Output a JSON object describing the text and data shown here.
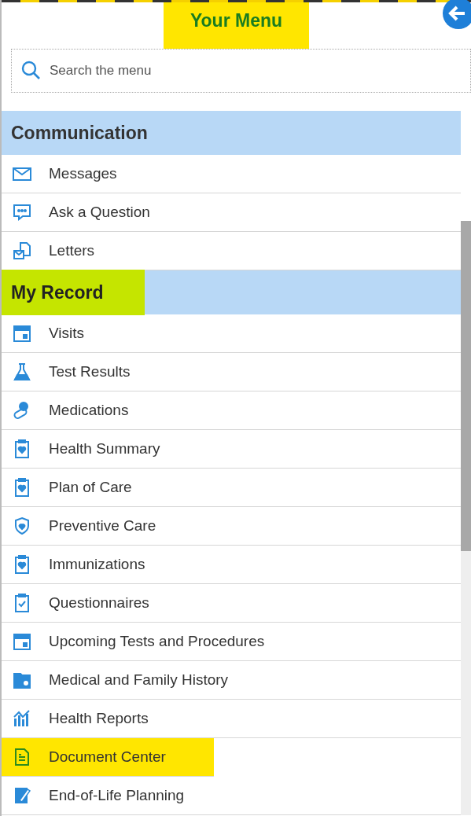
{
  "header": {
    "title": "Your Menu",
    "highlighted": true
  },
  "search": {
    "placeholder": "Search the menu"
  },
  "sections": [
    {
      "title": "Communication",
      "highlighted": false,
      "items": [
        {
          "label": "Messages",
          "kind": "envelope",
          "highlighted": false
        },
        {
          "label": "Ask a Question",
          "kind": "chat",
          "highlighted": false
        },
        {
          "label": "Letters",
          "kind": "letter",
          "highlighted": false
        }
      ]
    },
    {
      "title": "My Record",
      "highlighted": true,
      "items": [
        {
          "label": "Visits",
          "kind": "calendar",
          "highlighted": false
        },
        {
          "label": "Test Results",
          "kind": "flask",
          "highlighted": false
        },
        {
          "label": "Medications",
          "kind": "pills",
          "highlighted": false
        },
        {
          "label": "Health Summary",
          "kind": "clipboard-heart",
          "highlighted": false
        },
        {
          "label": "Plan of Care",
          "kind": "clipboard-heart",
          "highlighted": false
        },
        {
          "label": "Preventive Care",
          "kind": "shield",
          "highlighted": false
        },
        {
          "label": "Immunizations",
          "kind": "clipboard-heart",
          "highlighted": false
        },
        {
          "label": "Questionnaires",
          "kind": "clipboard-check",
          "highlighted": false
        },
        {
          "label": "Upcoming Tests and Procedures",
          "kind": "calendar",
          "highlighted": false
        },
        {
          "label": "Medical and Family History",
          "kind": "folder",
          "highlighted": false
        },
        {
          "label": "Health Reports",
          "kind": "chart",
          "highlighted": false
        },
        {
          "label": "Document Center",
          "kind": "document",
          "highlighted": true
        },
        {
          "label": "End-of-Life Planning",
          "kind": "pen",
          "highlighted": false
        }
      ]
    }
  ]
}
